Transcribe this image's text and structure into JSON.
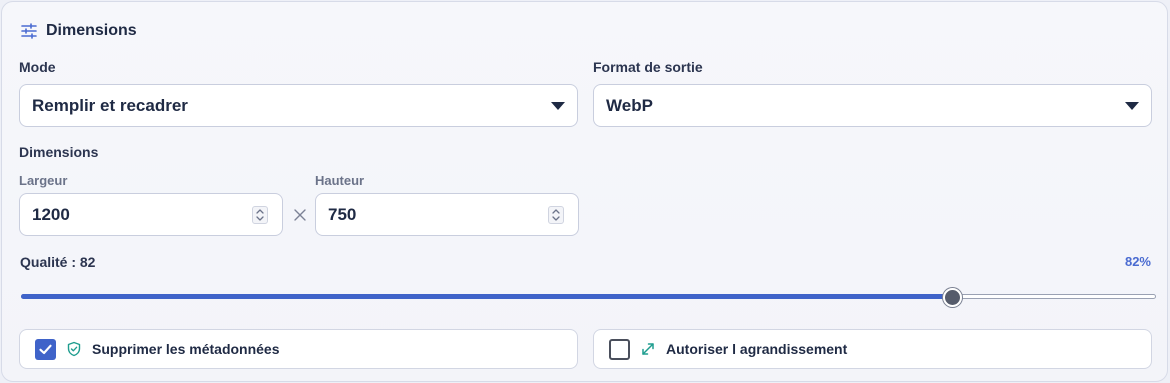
{
  "section": {
    "title": "Dimensions",
    "icon": "sliders-icon"
  },
  "mode": {
    "label": "Mode",
    "value": "Remplir et recadrer"
  },
  "format": {
    "label": "Format de sortie",
    "value": "WebP"
  },
  "dimensions": {
    "label": "Dimensions",
    "width": {
      "label": "Largeur",
      "value": "1200"
    },
    "separator_icon": "times-icon",
    "height": {
      "label": "Hauteur",
      "value": "750"
    }
  },
  "quality": {
    "label": "Qualité : 82",
    "percent_text": "82%",
    "value": 82,
    "min": 0,
    "max": 100
  },
  "options": {
    "strip_metadata": {
      "label": "Supprimer les métadonnées",
      "checked": true,
      "icon": "shield-check-icon"
    },
    "allow_upscale": {
      "label": "Autoriser l agrandissement",
      "checked": false,
      "icon": "expand-arrows-icon"
    }
  },
  "colors": {
    "accent": "#3f63c9",
    "teal_icon": "#1f9d8f",
    "text": "#1f2a44"
  }
}
